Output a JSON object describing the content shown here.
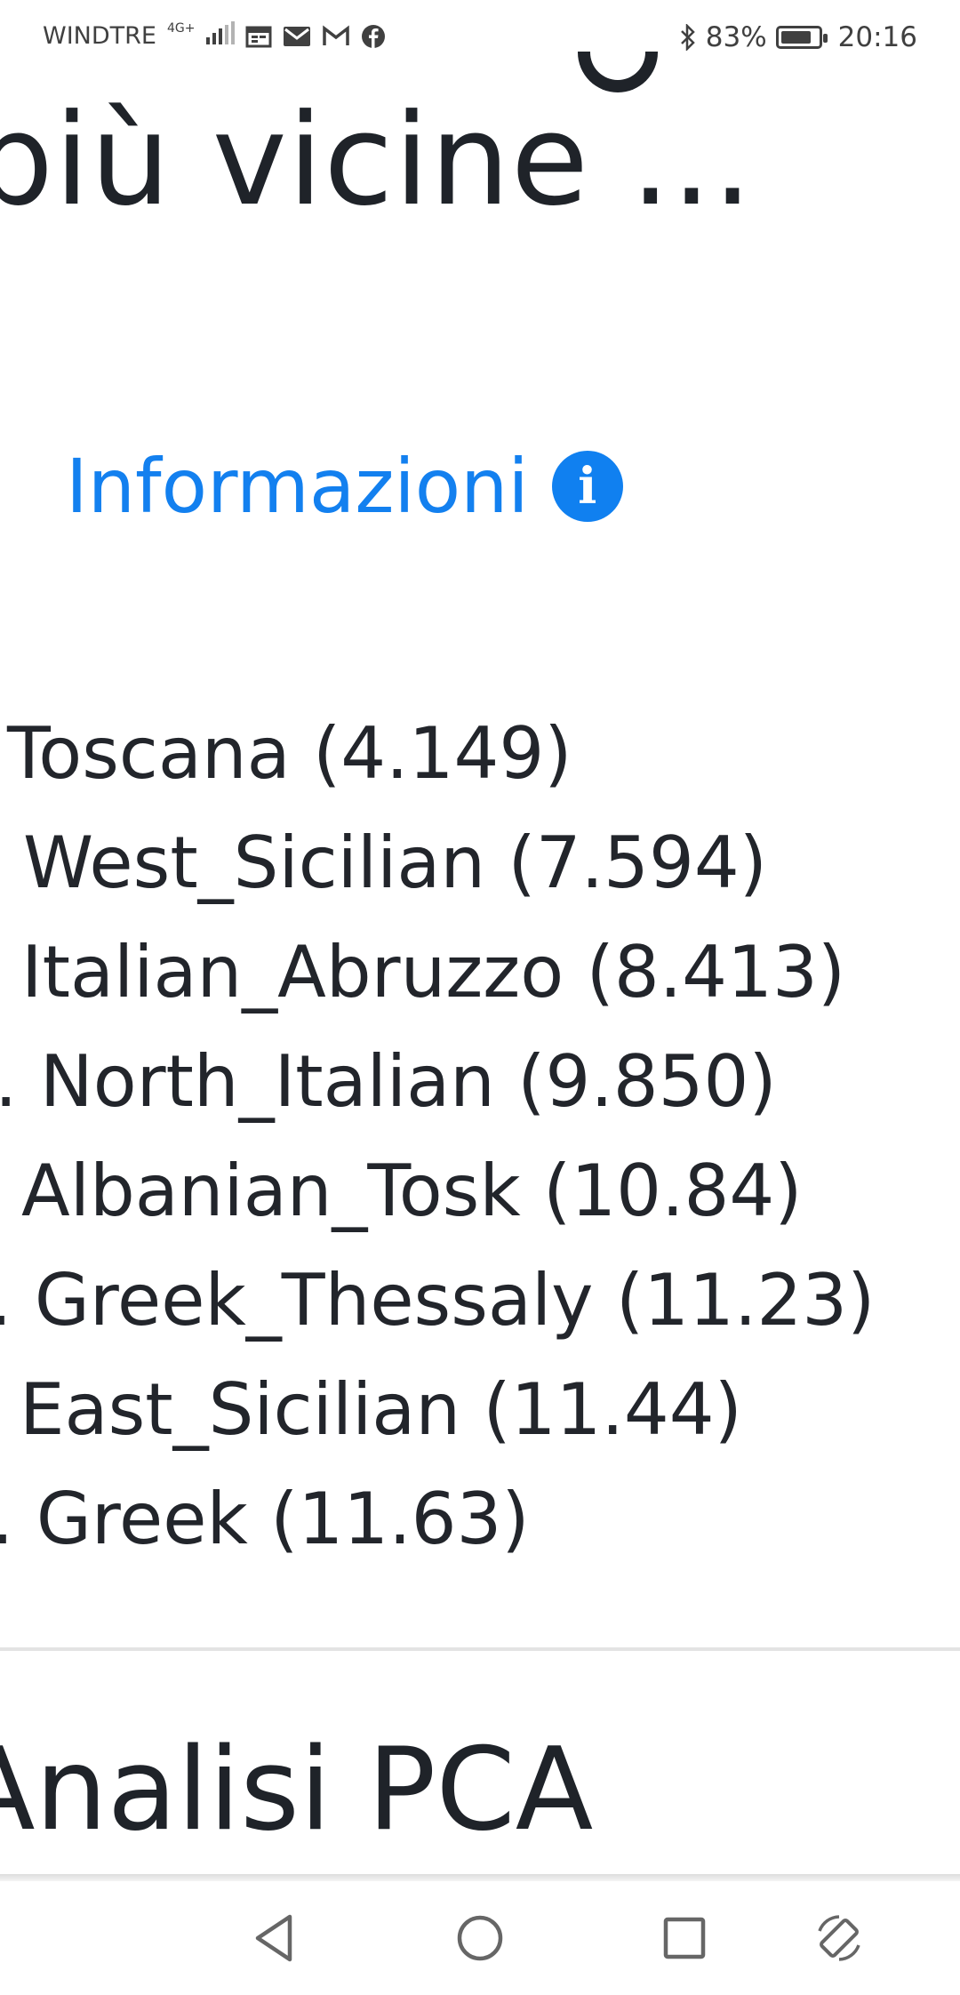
{
  "status_bar": {
    "carrier": "WINDTRE",
    "network": "4G+",
    "bluetooth_icon": "bluetooth-icon",
    "battery_percent": "83%",
    "battery_level": 0.83,
    "time": "20:16",
    "notification_icons": [
      "calendar-icon",
      "email-icon",
      "gmail-icon",
      "facebook-icon"
    ]
  },
  "page": {
    "heading": "più vicine ...",
    "info_link": "Informazioni",
    "info_icon": "info-circle-icon",
    "populations": [
      {
        "prefix": "",
        "text": "Toscana (4.149)"
      },
      {
        "prefix": "",
        "text": "West_Sicilian (7.594)"
      },
      {
        "prefix": "",
        "text": "Italian_Abruzzo (8.413)"
      },
      {
        "prefix": ".",
        "text": "North_Italian (9.850)"
      },
      {
        "prefix": "",
        "text": "Albanian_Tosk (10.84)"
      },
      {
        "prefix": ".",
        "text": "Greek_Thessaly (11.23)"
      },
      {
        "prefix": "",
        "text": "East_Sicilian (11.44)"
      },
      {
        "prefix": ".",
        "text": "Greek (11.63)"
      }
    ],
    "section_title": "Analisi PCA"
  },
  "nav_bar": {
    "back": "back-triangle-icon",
    "home": "home-circle-icon",
    "recents": "recents-square-icon",
    "rotate": "rotate-screen-icon"
  }
}
